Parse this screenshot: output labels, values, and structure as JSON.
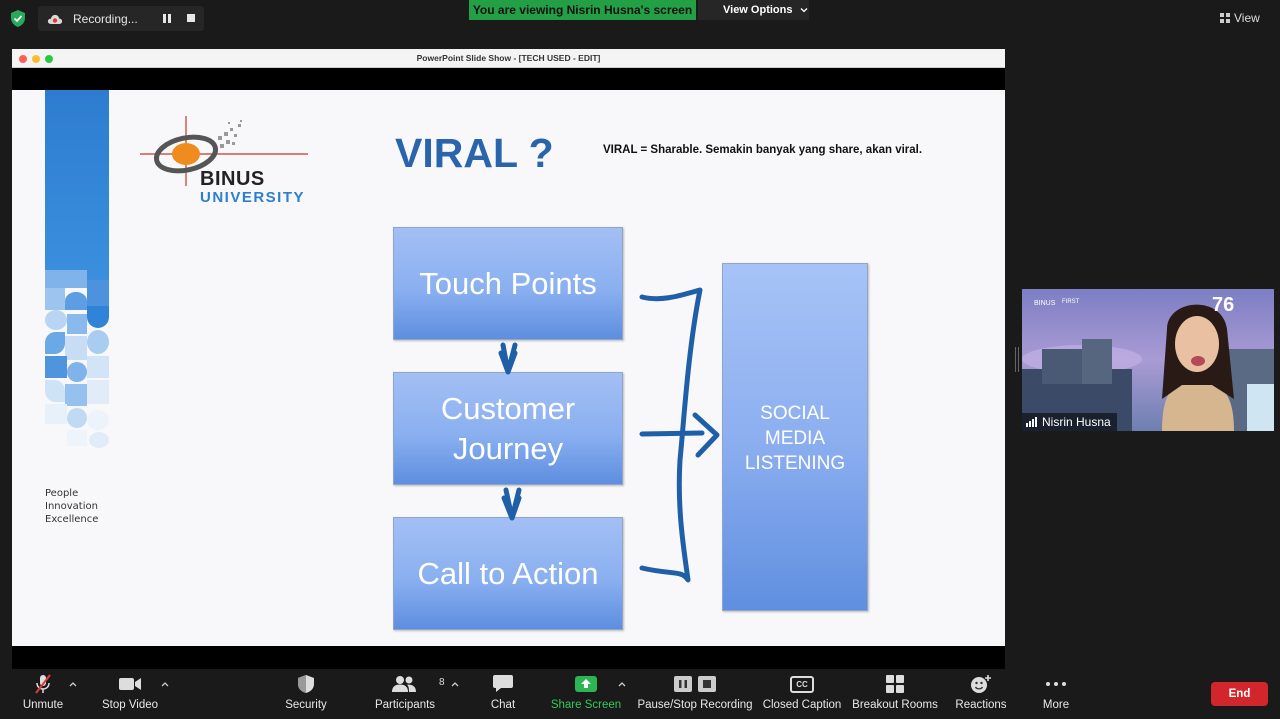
{
  "top_bar": {
    "recording_label": "Recording...",
    "viewing_banner": "You are viewing Nisrin Husna's screen",
    "view_options_label": "View Options",
    "view_label": "View"
  },
  "window": {
    "title": "PowerPoint Slide Show - [TECH USED - EDIT]"
  },
  "slide": {
    "logo_line1": "BINUS",
    "logo_line2": "UNIVERSITY",
    "tagline": [
      "People",
      "Innovation",
      "Excellence"
    ],
    "title": "VIRAL ?",
    "definition": "VIRAL = Sharable. Semakin banyak yang share, akan viral.",
    "boxes": {
      "touch_points": "Touch Points",
      "customer_journey_1": "Customer",
      "customer_journey_2": "Journey",
      "call_to_action": "Call to Action",
      "social_1": "SOCIAL",
      "social_2": "MEDIA",
      "social_3": "LISTENING"
    },
    "colors": {
      "title_blue": "#2a64ab",
      "box_blue": "#8ab0f0",
      "ink_blue": "#1f5fa8"
    }
  },
  "participant": {
    "name": "Nisrin Husna"
  },
  "toolbar": {
    "unmute": "Unmute",
    "stop_video": "Stop Video",
    "security": "Security",
    "participants": "Participants",
    "participants_count": "8",
    "chat": "Chat",
    "share_screen": "Share Screen",
    "pause_stop_recording": "Pause/Stop Recording",
    "closed_caption": "Closed Caption",
    "cc_badge": "CC",
    "breakout_rooms": "Breakout Rooms",
    "reactions": "Reactions",
    "more": "More",
    "end": "End"
  }
}
